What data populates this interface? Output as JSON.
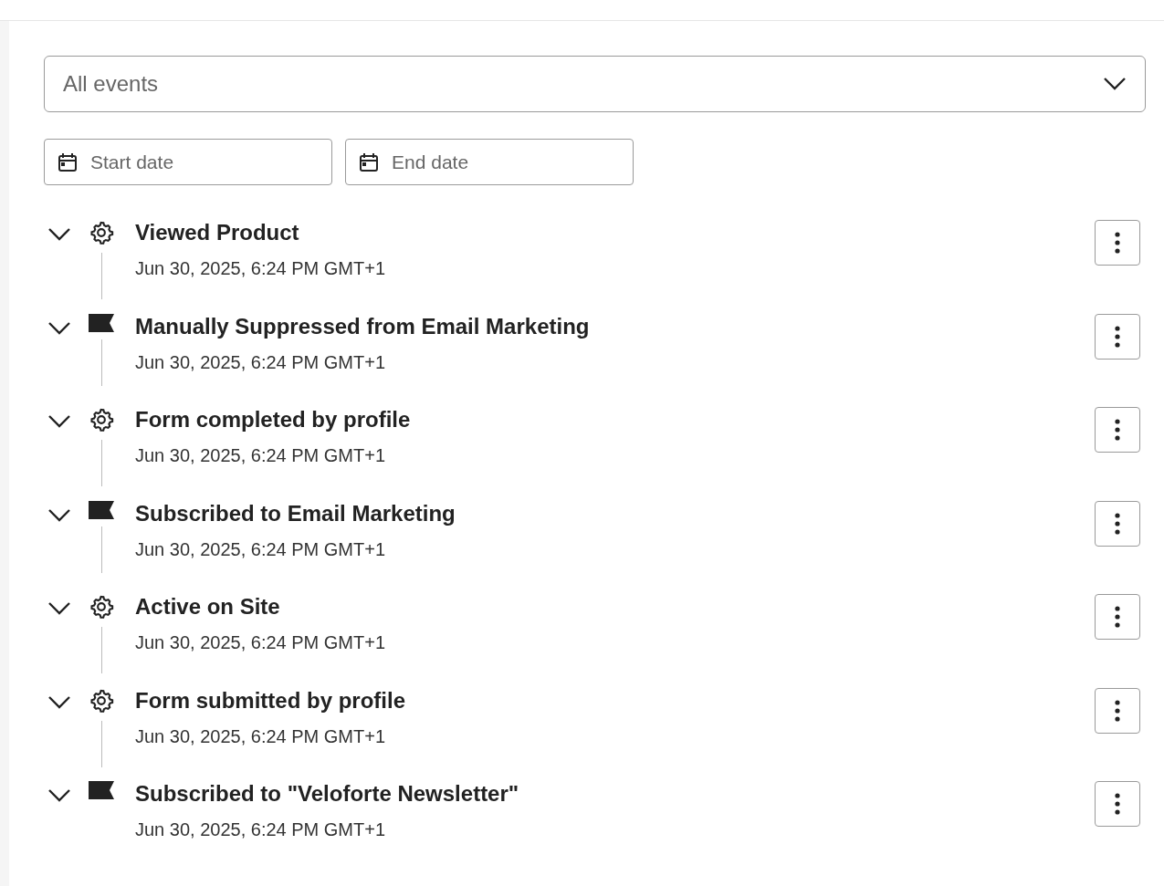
{
  "filter": {
    "placeholder": "All events"
  },
  "dates": [
    {
      "placeholder": "Start date"
    },
    {
      "placeholder": "End date"
    }
  ],
  "events": [
    {
      "kind": "gear",
      "title": "Viewed Product",
      "time": "Jun 30, 2025, 6:24 PM GMT+1"
    },
    {
      "kind": "flag",
      "title": "Manually Suppressed from Email Marketing",
      "time": "Jun 30, 2025, 6:24 PM GMT+1"
    },
    {
      "kind": "gear",
      "title": "Form completed by profile",
      "time": "Jun 30, 2025, 6:24 PM GMT+1"
    },
    {
      "kind": "flag",
      "title": "Subscribed to Email Marketing",
      "time": "Jun 30, 2025, 6:24 PM GMT+1"
    },
    {
      "kind": "gear",
      "title": "Active on Site",
      "time": "Jun 30, 2025, 6:24 PM GMT+1"
    },
    {
      "kind": "gear",
      "title": "Form submitted by profile",
      "time": "Jun 30, 2025, 6:24 PM GMT+1"
    },
    {
      "kind": "flag",
      "title": "Subscribed to \"Veloforte Newsletter\"",
      "time": "Jun 30, 2025, 6:24 PM GMT+1"
    }
  ]
}
